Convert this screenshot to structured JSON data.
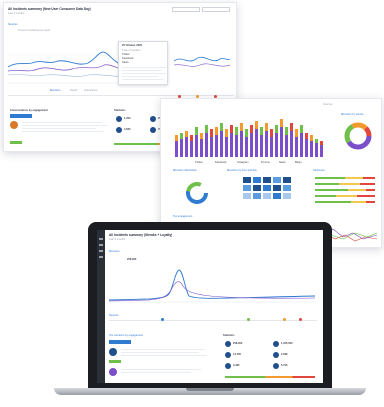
{
  "top_panel": {
    "title": "All Incidents summary (New User Consumer Data Day)",
    "subtitle": "Last 3 months",
    "section_label": "Sources",
    "chart_caption": "Trend of mentions per week",
    "tooltip_title": "25 October 2020",
    "tooltip_lines": [
      "Type of mention",
      "Twitter",
      "Facebook",
      "News"
    ],
    "tabs": [
      "Mentions",
      "Reach",
      "Interactions"
    ],
    "engagement_title": "Conversations by engagement",
    "kpi_title": "Statistics",
    "kpis": [
      "1,200",
      "258,000",
      "10,400",
      "4,560",
      "79%",
      "1,900"
    ]
  },
  "middle_panel": {
    "header": "Sources",
    "donut_title": "Mentions by source",
    "heatmap_title": "Mentions by hour and day",
    "sentiment_title": "Sentiment",
    "dist_title": "Mentions distribution",
    "engagement_title": "Top engagement",
    "legend": [
      "Twitter",
      "Facebook",
      "Instagram",
      "Forums",
      "News",
      "Blogs"
    ]
  },
  "laptop": {
    "title": "All Incidents summary (Streaks + Loyalty)",
    "subtitle": "Last 3 months",
    "metric_label": "Mentions",
    "metric_value": "258,000",
    "section": "Sources",
    "engagement_title": "Top mentions by engagement",
    "stats_title": "Statistics",
    "stat_values": [
      "258,000",
      "1,345,000",
      "13,700",
      "2,098",
      "3,480",
      "5,700"
    ]
  },
  "colors": {
    "accent": "#2e7bd1",
    "purple": "#7a4fc9",
    "green": "#6fbf4a",
    "orange": "#f29a2e",
    "red": "#e2463d",
    "navy": "#1f4f8c"
  }
}
